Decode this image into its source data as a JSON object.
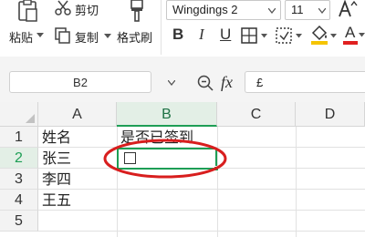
{
  "ribbon": {
    "paste_label": "粘贴",
    "cut_label": "剪切",
    "copy_label": "复制",
    "format_painter_label": "格式刷",
    "font_name": "Wingdings 2",
    "font_size": "11",
    "bold": "B",
    "italic": "I",
    "underline": "U",
    "font_color_letter": "A"
  },
  "formula_bar": {
    "name_box": "B2",
    "fx_label": "fx",
    "formula_value": "£"
  },
  "sheet": {
    "columns": [
      "A",
      "B",
      "C",
      "D"
    ],
    "rows": [
      "1",
      "2",
      "3",
      "4",
      "5"
    ],
    "cells": {
      "A1": "姓名",
      "B1": "是否已签到",
      "A2": "张三",
      "A3": "李四",
      "A4": "王五"
    }
  },
  "colors": {
    "accent": "#1e9e55",
    "annotation": "#d81e1e"
  }
}
